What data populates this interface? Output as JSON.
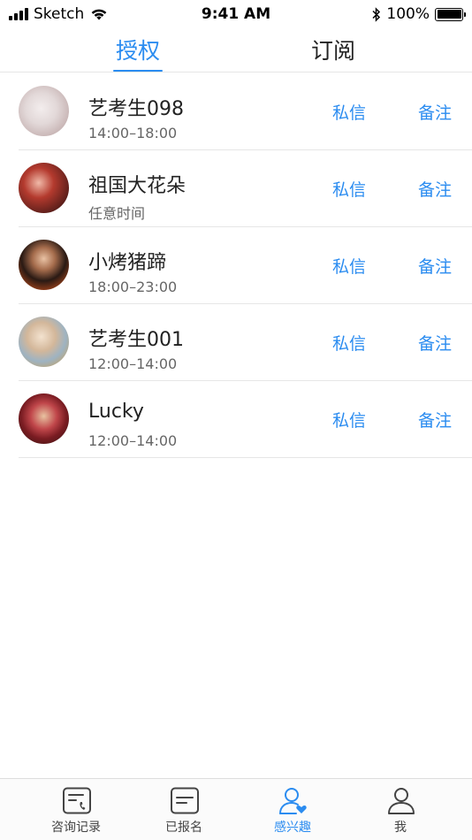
{
  "status_bar": {
    "carrier": "Sketch",
    "time": "9:41 AM",
    "battery": "100%"
  },
  "tabs": [
    {
      "label": "授权",
      "active": true
    },
    {
      "label": "订阅",
      "active": false
    }
  ],
  "list": [
    {
      "name": "艺考生098",
      "time": "14:00–18:00",
      "message": "私信",
      "note": "备注"
    },
    {
      "name": "祖国大花朵",
      "time": "任意时间",
      "message": "私信",
      "note": "备注"
    },
    {
      "name": "小烤猪蹄",
      "time": "18:00–23:00",
      "message": "私信",
      "note": "备注"
    },
    {
      "name": "艺考生001",
      "time": "12:00–14:00",
      "message": "私信",
      "note": "备注"
    },
    {
      "name": "Lucky",
      "time": "12:00–14:00",
      "message": "私信",
      "note": "备注"
    }
  ],
  "tabbar": [
    {
      "label": "咨询记录",
      "icon": "phone-note-icon",
      "active": false
    },
    {
      "label": "已报名",
      "icon": "message-box-icon",
      "active": false
    },
    {
      "label": "感兴趣",
      "icon": "user-heart-icon",
      "active": true
    },
    {
      "label": "我",
      "icon": "user-icon",
      "active": false
    }
  ],
  "colors": {
    "accent": "#2b8cf0",
    "text": "#222222",
    "subtext": "#666666",
    "divider": "#e6e6e6"
  }
}
